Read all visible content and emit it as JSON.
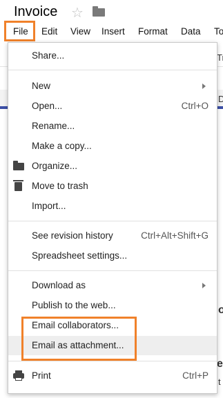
{
  "document": {
    "title": "Invoice"
  },
  "menubar": [
    "File",
    "Edit",
    "View",
    "Insert",
    "Format",
    "Data",
    "To"
  ],
  "file_menu": {
    "share": "Share...",
    "new": "New",
    "open": "Open...",
    "open_shortcut": "Ctrl+O",
    "rename": "Rename...",
    "make_copy": "Make a copy...",
    "organize": "Organize...",
    "move_to_trash": "Move to trash",
    "import": "Import...",
    "revision_history": "See revision history",
    "revision_shortcut": "Ctrl+Alt+Shift+G",
    "spreadsheet_settings": "Spreadsheet settings...",
    "download_as": "Download as",
    "publish": "Publish to the web...",
    "email_collaborators": "Email collaborators...",
    "email_attachment": "Email as attachment...",
    "print": "Print",
    "print_shortcut": "Ctrl+P"
  },
  "background_peeks": {
    "toolbar_text": "Tr",
    "col_header": "D",
    "cell_a": "ol",
    "cell_b": "e(",
    "cell_c": "t"
  },
  "colors": {
    "highlight": "#f0812a",
    "selection": "#3c4fa6"
  },
  "icons": {
    "star": "star-icon",
    "folder": "folder-icon",
    "organize": "folder-icon",
    "trash": "trash-icon",
    "print": "print-icon",
    "submenu": "chevron-right-icon"
  }
}
